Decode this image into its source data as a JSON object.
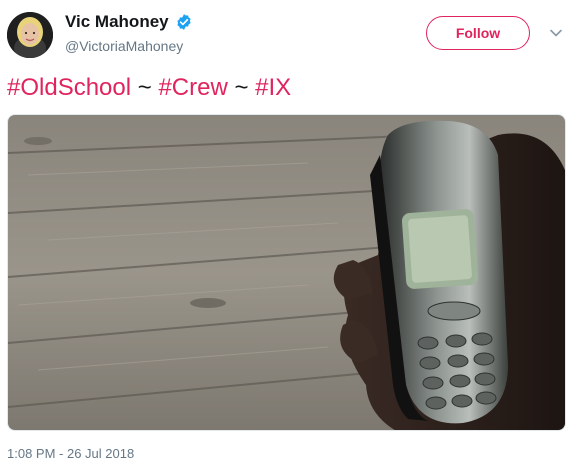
{
  "author": {
    "display_name": "Vic Mahoney",
    "handle": "@VictoriaMahoney",
    "verified": true
  },
  "follow_button": {
    "label": "Follow"
  },
  "tweet": {
    "hashtags": [
      "#OldSchool",
      "#Crew",
      "#IX"
    ],
    "separator": "~"
  },
  "media": {
    "description_icon": "photo-icon"
  },
  "timestamp": "1:08 PM - 26 Jul 2018",
  "colors": {
    "accent": "#e0245e",
    "verified": "#1da1f2",
    "secondary_text": "#657786"
  }
}
